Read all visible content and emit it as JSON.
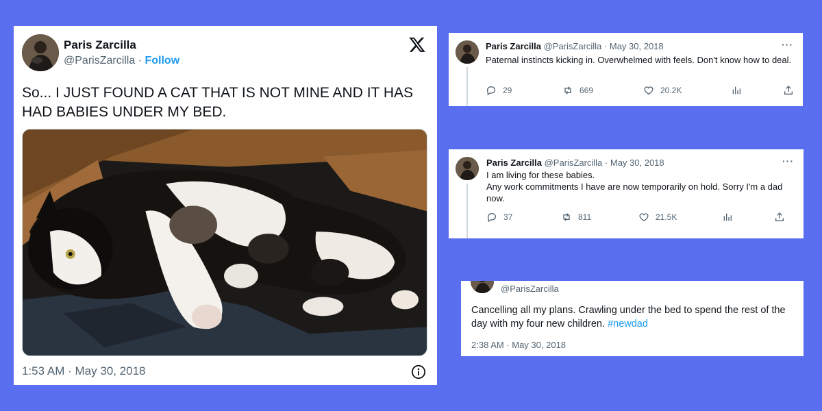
{
  "main_tweet": {
    "author_name": "Paris Zarcilla",
    "handle": "@ParisZarcilla",
    "separator": " · ",
    "follow_label": "Follow",
    "text": "So... I JUST FOUND A CAT THAT IS NOT MINE AND IT HAS HAD BABIES UNDER MY BED.",
    "timestamp": "1:53 AM · May 30, 2018",
    "logo_icon": "x-logo-icon",
    "info_icon": "info-icon",
    "photo_subject": "cat-with-kittens-photo"
  },
  "replies": [
    {
      "author_name": "Paris Zarcilla",
      "handle": "@ParisZarcilla",
      "date": "· May 30, 2018",
      "more": "···",
      "text": "Paternal instincts kicking in. Overwhelmed with feels. Don't know how to deal.",
      "stats": {
        "replies": "29",
        "retweets": "669",
        "likes": "20.2K"
      }
    },
    {
      "author_name": "Paris Zarcilla",
      "handle": "@ParisZarcilla",
      "date": "· May 30, 2018",
      "more": "···",
      "text_line1": "I am living for these babies.",
      "text_line2": "Any work commitments I have are now temporarily on hold. Sorry I'm a dad now.",
      "stats": {
        "replies": "37",
        "retweets": "811",
        "likes": "21.5K"
      }
    },
    {
      "handle": "@ParisZarcilla",
      "text": "Cancelling all my plans. Crawling under the bed to spend the rest of the day with my four new children.",
      "hashtag": "#newdad",
      "timestamp": "2:38 AM · May 30, 2018"
    }
  ],
  "colors": {
    "background": "#5a6ff0",
    "card": "#ffffff",
    "accent": "#1d9bf0",
    "secondary_text": "#536471",
    "primary_text": "#0f1419"
  }
}
